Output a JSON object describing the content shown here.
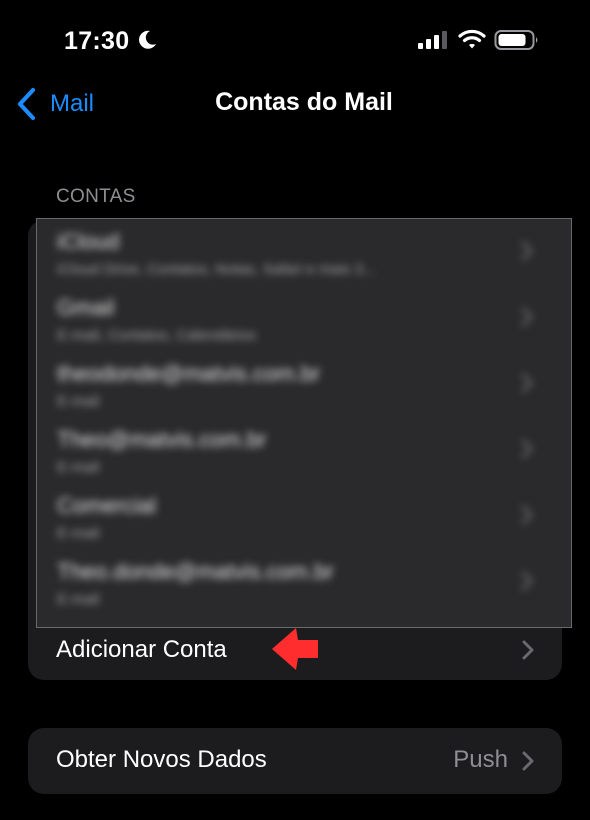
{
  "status_bar": {
    "time": "17:30",
    "icons": [
      "moon-icon",
      "cellular-signal-icon",
      "wifi-icon",
      "battery-icon"
    ]
  },
  "nav": {
    "back_label": "Mail",
    "title": "Contas do Mail"
  },
  "accounts_section": {
    "header": "CONTAS",
    "accounts": [
      {
        "name": "iCloud",
        "detail": "iCloud Drive, Contatos, Notas, Safari e mais 3..."
      },
      {
        "name": "Gmail",
        "detail": "E-mail, Contatos, Calendários"
      },
      {
        "name": "theodonde@matvis.com.br",
        "detail": "E-mail"
      },
      {
        "name": "Theo@matvis.com.br",
        "detail": "E-mail"
      },
      {
        "name": "Comercial",
        "detail": "E-mail"
      },
      {
        "name": "Theo.donde@matvis.com.br",
        "detail": "E-mail"
      }
    ],
    "add_account_label": "Adicionar Conta"
  },
  "fetch_section": {
    "label": "Obter Novos Dados",
    "value": "Push"
  },
  "colors": {
    "accent": "#1a8cff",
    "background": "#000000",
    "cell": "#1c1c1e",
    "secondary_text": "#8e8e93",
    "annotation_arrow": "#ff2d2d"
  }
}
